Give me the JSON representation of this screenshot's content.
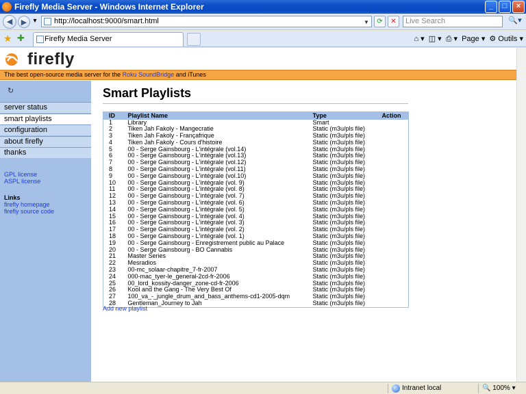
{
  "window": {
    "title": "Firefly Media Server - Windows Internet Explorer",
    "minimize": "_",
    "maximize": "□",
    "close": "×"
  },
  "address_bar": {
    "url": "http://localhost:9000/smart.html",
    "search_placeholder": "Live Search"
  },
  "tab": {
    "label": "Firefly Media Server"
  },
  "toolbar": {
    "page_label": "Page",
    "tools_label": "Outils"
  },
  "site": {
    "logo_text": "firefly",
    "tagline_prefix": "The best open-source media server for the",
    "tagline_link": "Roku SoundBridge",
    "tagline_suffix": "and iTunes"
  },
  "sidebar": {
    "items": [
      {
        "label": "server status",
        "active": false
      },
      {
        "label": "smart playlists",
        "active": true
      },
      {
        "label": "configuration",
        "active": false
      },
      {
        "label": "about firefly",
        "active": false
      },
      {
        "label": "thanks",
        "active": false
      }
    ],
    "license_links": [
      "GPL license",
      "ASPL license"
    ],
    "links_heading": "Links",
    "links": [
      "firefly homepage",
      "firefly source code"
    ]
  },
  "main": {
    "title": "Smart Playlists",
    "columns": [
      "ID",
      "Playlist Name",
      "Type",
      "Action"
    ],
    "rows": [
      {
        "id": "1",
        "name": "Library",
        "type": "Smart"
      },
      {
        "id": "2",
        "name": "Tiken Jah Fakoly - Mangecratie",
        "type": "Static (m3u/pls file)"
      },
      {
        "id": "3",
        "name": "Tiken Jah Fakoly - Françafrique",
        "type": "Static (m3u/pls file)"
      },
      {
        "id": "4",
        "name": "Tiken Jah Fakoly - Cours d'histoire",
        "type": "Static (m3u/pls file)"
      },
      {
        "id": "5",
        "name": "00 - Serge Gainsbourg - L'intégrale (vol.14)",
        "type": "Static (m3u/pls file)"
      },
      {
        "id": "6",
        "name": "00 - Serge Gainsbourg - L'intégrale (vol.13)",
        "type": "Static (m3u/pls file)"
      },
      {
        "id": "7",
        "name": "00 - Serge Gainsbourg - L'intégrale (vol.12)",
        "type": "Static (m3u/pls file)"
      },
      {
        "id": "8",
        "name": "00 - Serge Gainsbourg - L'intégrale (vol.11)",
        "type": "Static (m3u/pls file)"
      },
      {
        "id": "9",
        "name": "00 - Serge Gainsbourg - L'intégrale (vol.10)",
        "type": "Static (m3u/pls file)"
      },
      {
        "id": "10",
        "name": "00 - Serge Gainsbourg - L'intégrale (vol. 9)",
        "type": "Static (m3u/pls file)"
      },
      {
        "id": "11",
        "name": "00 - Serge Gainsbourg - L'intégrale (vol. 8)",
        "type": "Static (m3u/pls file)"
      },
      {
        "id": "12",
        "name": "00 - Serge Gainsbourg - L'intégrale (vol. 7)",
        "type": "Static (m3u/pls file)"
      },
      {
        "id": "13",
        "name": "00 - Serge Gainsbourg - L'intégrale (vol. 6)",
        "type": "Static (m3u/pls file)"
      },
      {
        "id": "14",
        "name": "00 - Serge Gainsbourg - L'intégrale (vol. 5)",
        "type": "Static (m3u/pls file)"
      },
      {
        "id": "15",
        "name": "00 - Serge Gainsbourg - L'intégrale (vol. 4)",
        "type": "Static (m3u/pls file)"
      },
      {
        "id": "16",
        "name": "00 - Serge Gainsbourg - L'intégrale (vol. 3)",
        "type": "Static (m3u/pls file)"
      },
      {
        "id": "17",
        "name": "00 - Serge Gainsbourg - L'intégrale (vol. 2)",
        "type": "Static (m3u/pls file)"
      },
      {
        "id": "18",
        "name": "00 - Serge Gainsbourg - L'intégrale (vol. 1)",
        "type": "Static (m3u/pls file)"
      },
      {
        "id": "19",
        "name": "00 - Serge Gainsbourg - Enregistrement public au Palace",
        "type": "Static (m3u/pls file)"
      },
      {
        "id": "20",
        "name": "00 - Serge Gainsbourg - BO Cannabis",
        "type": "Static (m3u/pls file)"
      },
      {
        "id": "21",
        "name": "Master Series",
        "type": "Static (m3u/pls file)"
      },
      {
        "id": "22",
        "name": "Mesradios",
        "type": "Static (m3u/pls file)"
      },
      {
        "id": "23",
        "name": "00-mc_solaar-chapitre_7-fr-2007",
        "type": "Static (m3u/pls file)"
      },
      {
        "id": "24",
        "name": "000-mac_tyer-le_general-2cd-fr-2006",
        "type": "Static (m3u/pls file)"
      },
      {
        "id": "25",
        "name": "00_lord_kossity-danger_zone-cd-fr-2006",
        "type": "Static (m3u/pls file)"
      },
      {
        "id": "26",
        "name": "Kool and the Gang - The Very Best Of",
        "type": "Static (m3u/pls file)"
      },
      {
        "id": "27",
        "name": "100_va_-_jungle_drum_and_bass_anthems-cd1-2005-dqm",
        "type": "Static (m3u/pls file)"
      },
      {
        "id": "28",
        "name": "Gentleman_Journey to Jah",
        "type": "Static (m3u/pls file)"
      }
    ],
    "add_link": "Add new playlist"
  },
  "status_bar": {
    "zone": "Intranet local",
    "zoom": "100%"
  },
  "colors": {
    "accent_blue": "#a4c0e6",
    "tagline_orange": "#f5a544",
    "link_blue": "#1a3ae8"
  }
}
